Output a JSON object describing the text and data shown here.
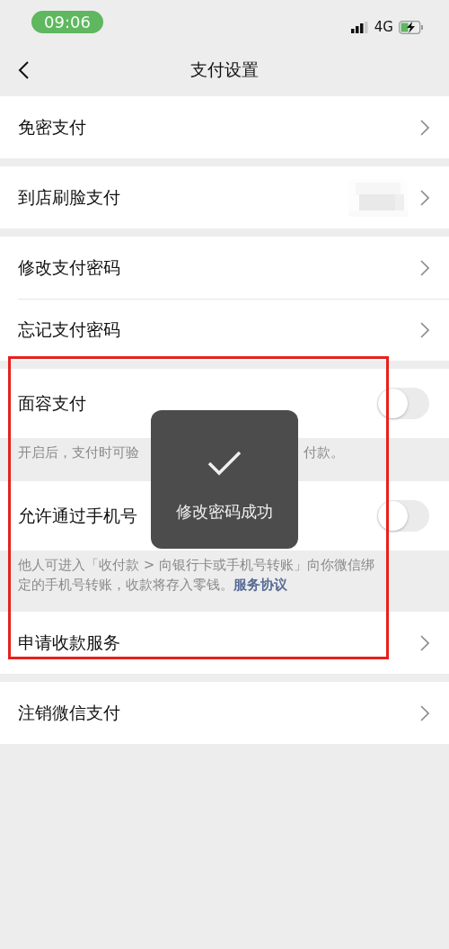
{
  "status_bar": {
    "time": "09:06",
    "network": "4G"
  },
  "nav": {
    "title": "支付设置"
  },
  "sections": [
    {
      "rows": [
        {
          "kind": "link",
          "label": "免密支付"
        }
      ]
    },
    {
      "rows": [
        {
          "kind": "link",
          "label": "到店刷脸支付"
        }
      ]
    },
    {
      "rows": [
        {
          "kind": "link",
          "label": "修改支付密码"
        },
        {
          "kind": "link",
          "label": "忘记支付密码"
        }
      ]
    },
    {
      "rows": [
        {
          "kind": "toggle",
          "label": "面容支付",
          "on": false
        }
      ],
      "note": {
        "parts": [
          "开启后，支付时可验",
          "付款。"
        ]
      }
    },
    {
      "rows": [
        {
          "kind": "toggle",
          "label": "允许通过手机号",
          "on": false
        }
      ],
      "note": {
        "text": "他人可进入「收付款 > 向银行卡或手机号转账」向你微信绑定的手机号转账，收款将存入零钱。",
        "link": "服务协议"
      }
    },
    {
      "rows": [
        {
          "kind": "link",
          "label": "申请收款服务"
        }
      ]
    },
    {
      "rows": [
        {
          "kind": "link",
          "label": "注销微信支付"
        }
      ]
    }
  ],
  "toast": {
    "text": "修改密码成功"
  },
  "annotation": {
    "kind": "frame"
  }
}
